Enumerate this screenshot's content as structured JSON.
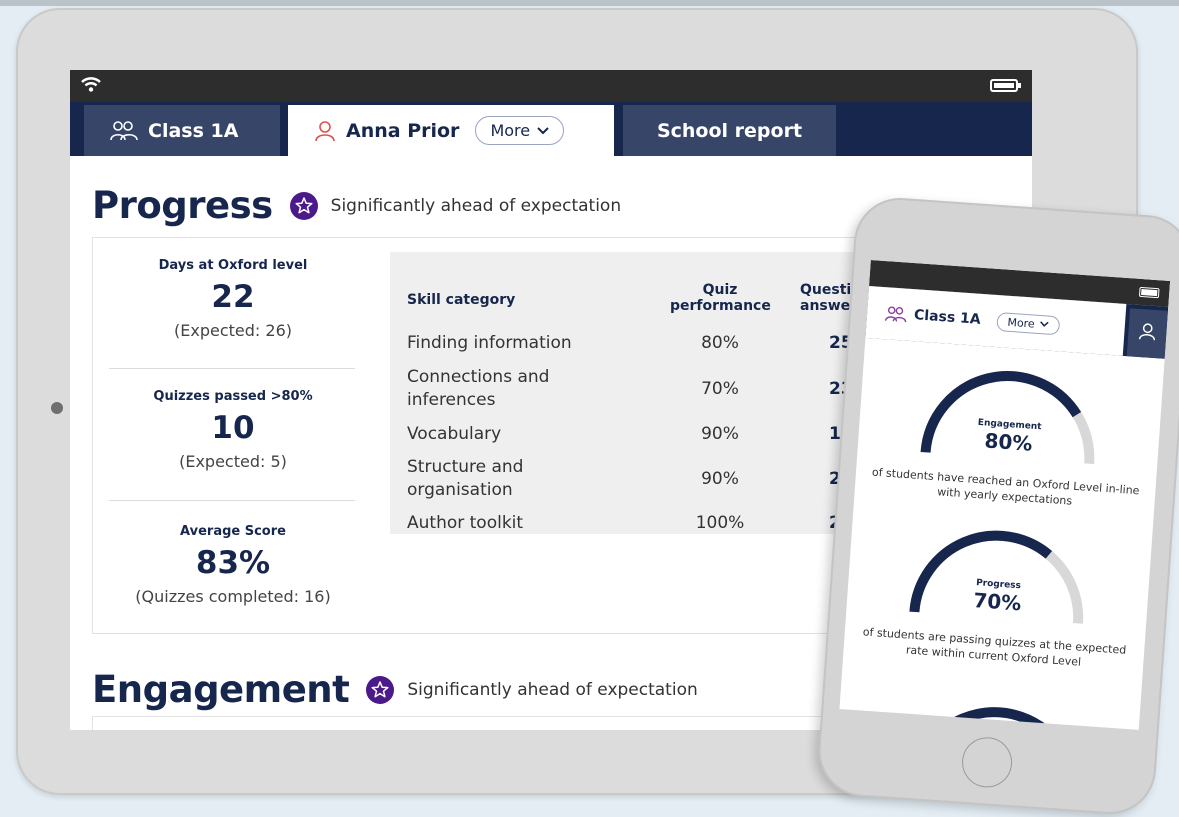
{
  "tablet": {
    "tabs": [
      {
        "label": "Class 1A"
      },
      {
        "label": "Anna Prior",
        "more_label": "More"
      },
      {
        "label": "School report"
      }
    ],
    "progress": {
      "title": "Progress",
      "note": "Significantly ahead of expectation",
      "stats": [
        {
          "label": "Days at Oxford level",
          "value": "22",
          "sub": "(Expected: 26)"
        },
        {
          "label": "Quizzes passed >80%",
          "value": "10",
          "sub": "(Expected: 5)"
        },
        {
          "label": "Average Score",
          "value": "83%",
          "sub": "(Quizzes completed: 16)"
        }
      ],
      "table": {
        "headers": {
          "skill": "Skill category",
          "quiz_line1": "Quiz",
          "quiz_line2": "performance",
          "q_line1": "Question",
          "q_line2": "answered"
        },
        "rows": [
          {
            "skill": "Finding information",
            "quiz": "80%",
            "questions": "25"
          },
          {
            "skill": "Connections and inferences",
            "quiz": "70%",
            "questions": "23"
          },
          {
            "skill": "Vocabulary",
            "quiz": "90%",
            "questions": "15"
          },
          {
            "skill": "Structure and organisation",
            "quiz": "90%",
            "questions": "24"
          },
          {
            "skill": "Author toolkit",
            "quiz": "100%",
            "questions": "27"
          }
        ]
      }
    },
    "engagement": {
      "title": "Engagement",
      "note": "Significantly ahead of expectation"
    }
  },
  "phone": {
    "tab_label": "Class 1A",
    "more_label": "More",
    "gauges": [
      {
        "label": "Engagement",
        "value": "80%",
        "fraction": 0.8,
        "description": "of students have reached an Oxford Level in-line with yearly expectations"
      },
      {
        "label": "Progress",
        "value": "70%",
        "fraction": 0.7,
        "description": "of students are passing quizzes at the expected rate within current Oxford Level"
      }
    ]
  },
  "colors": {
    "navy": "#16264d",
    "tab_inactive": "#374668",
    "badge_purple": "#4b1a8a",
    "gauge_track": "#d8d8d8"
  }
}
